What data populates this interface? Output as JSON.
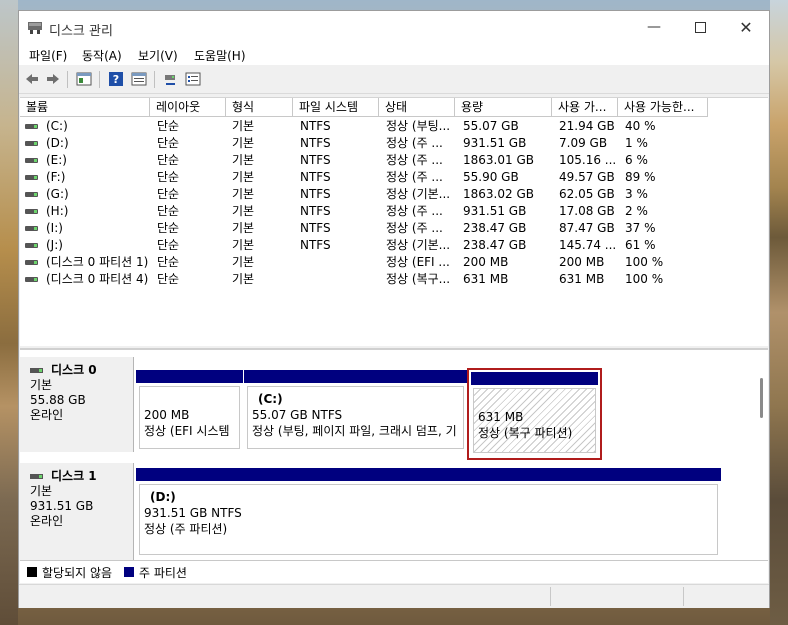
{
  "window": {
    "title": "디스크 관리"
  },
  "menu": [
    "파일(F)",
    "동작(A)",
    "보기(V)",
    "도움말(H)"
  ],
  "toolbar": [
    "back-icon",
    "forward-icon",
    "show-hide-tree-icon",
    "help-icon",
    "properties-icon",
    "connect-icon",
    "settings-icon"
  ],
  "columns": [
    "볼륨",
    "레이아웃",
    "형식",
    "파일 시스템",
    "상태",
    "용량",
    "사용 가...",
    "사용 가능한..."
  ],
  "volumes": [
    {
      "name": "(C:)",
      "layout": "단순",
      "type": "기본",
      "fs": "NTFS",
      "status": "정상 (부팅...",
      "cap": "55.07 GB",
      "free": "21.94 GB",
      "pct": "40 %"
    },
    {
      "name": "(D:)",
      "layout": "단순",
      "type": "기본",
      "fs": "NTFS",
      "status": "정상 (주 ...",
      "cap": "931.51 GB",
      "free": "7.09 GB",
      "pct": "1 %"
    },
    {
      "name": "(E:)",
      "layout": "단순",
      "type": "기본",
      "fs": "NTFS",
      "status": "정상 (주 ...",
      "cap": "1863.01 GB",
      "free": "105.16 ...",
      "pct": "6 %"
    },
    {
      "name": "(F:)",
      "layout": "단순",
      "type": "기본",
      "fs": "NTFS",
      "status": "정상 (주 ...",
      "cap": "55.90 GB",
      "free": "49.57 GB",
      "pct": "89 %"
    },
    {
      "name": "(G:)",
      "layout": "단순",
      "type": "기본",
      "fs": "NTFS",
      "status": "정상 (기본...",
      "cap": "1863.02 GB",
      "free": "62.05 GB",
      "pct": "3 %"
    },
    {
      "name": "(H:)",
      "layout": "단순",
      "type": "기본",
      "fs": "NTFS",
      "status": "정상 (주 ...",
      "cap": "931.51 GB",
      "free": "17.08 GB",
      "pct": "2 %"
    },
    {
      "name": "(I:)",
      "layout": "단순",
      "type": "기본",
      "fs": "NTFS",
      "status": "정상 (주 ...",
      "cap": "238.47 GB",
      "free": "87.47 GB",
      "pct": "37 %"
    },
    {
      "name": "(J:)",
      "layout": "단순",
      "type": "기본",
      "fs": "NTFS",
      "status": "정상 (기본...",
      "cap": "238.47 GB",
      "free": "145.74 ...",
      "pct": "61 %"
    },
    {
      "name": "(디스크 0 파티션 1)",
      "layout": "단순",
      "type": "기본",
      "fs": "",
      "status": "정상 (EFI ...",
      "cap": "200 MB",
      "free": "200 MB",
      "pct": "100 %"
    },
    {
      "name": "(디스크 0 파티션 4)",
      "layout": "단순",
      "type": "기본",
      "fs": "",
      "status": "정상 (복구...",
      "cap": "631 MB",
      "free": "631 MB",
      "pct": "100 %"
    }
  ],
  "disks": [
    {
      "name": "디스크 0",
      "type": "기본",
      "size": "55.88 GB",
      "state": "온라인",
      "parts": [
        {
          "line1": "",
          "line2": "200 MB",
          "line3": "정상 (EFI 시스템"
        },
        {
          "line1": "(C:)",
          "line2": "55.07 GB NTFS",
          "line3": "정상 (부팅, 페이지 파일, 크래시 덤프, 기"
        },
        {
          "line1": "",
          "line2": "631 MB",
          "line3": "정상 (복구 파티션)"
        }
      ]
    },
    {
      "name": "디스크 1",
      "type": "기본",
      "size": "931.51 GB",
      "state": "온라인",
      "parts": [
        {
          "line1": "(D:)",
          "line2": "931.51 GB NTFS",
          "line3": "정상 (주 파티션)"
        }
      ]
    }
  ],
  "legend": {
    "unallocated": "할당되지 않음",
    "primary": "주 파티션",
    "unallocated_color": "#000000",
    "primary_color": "#00007f"
  },
  "colors": {
    "partition_bar": "#00007f",
    "selected_border": "#b01c1c"
  }
}
